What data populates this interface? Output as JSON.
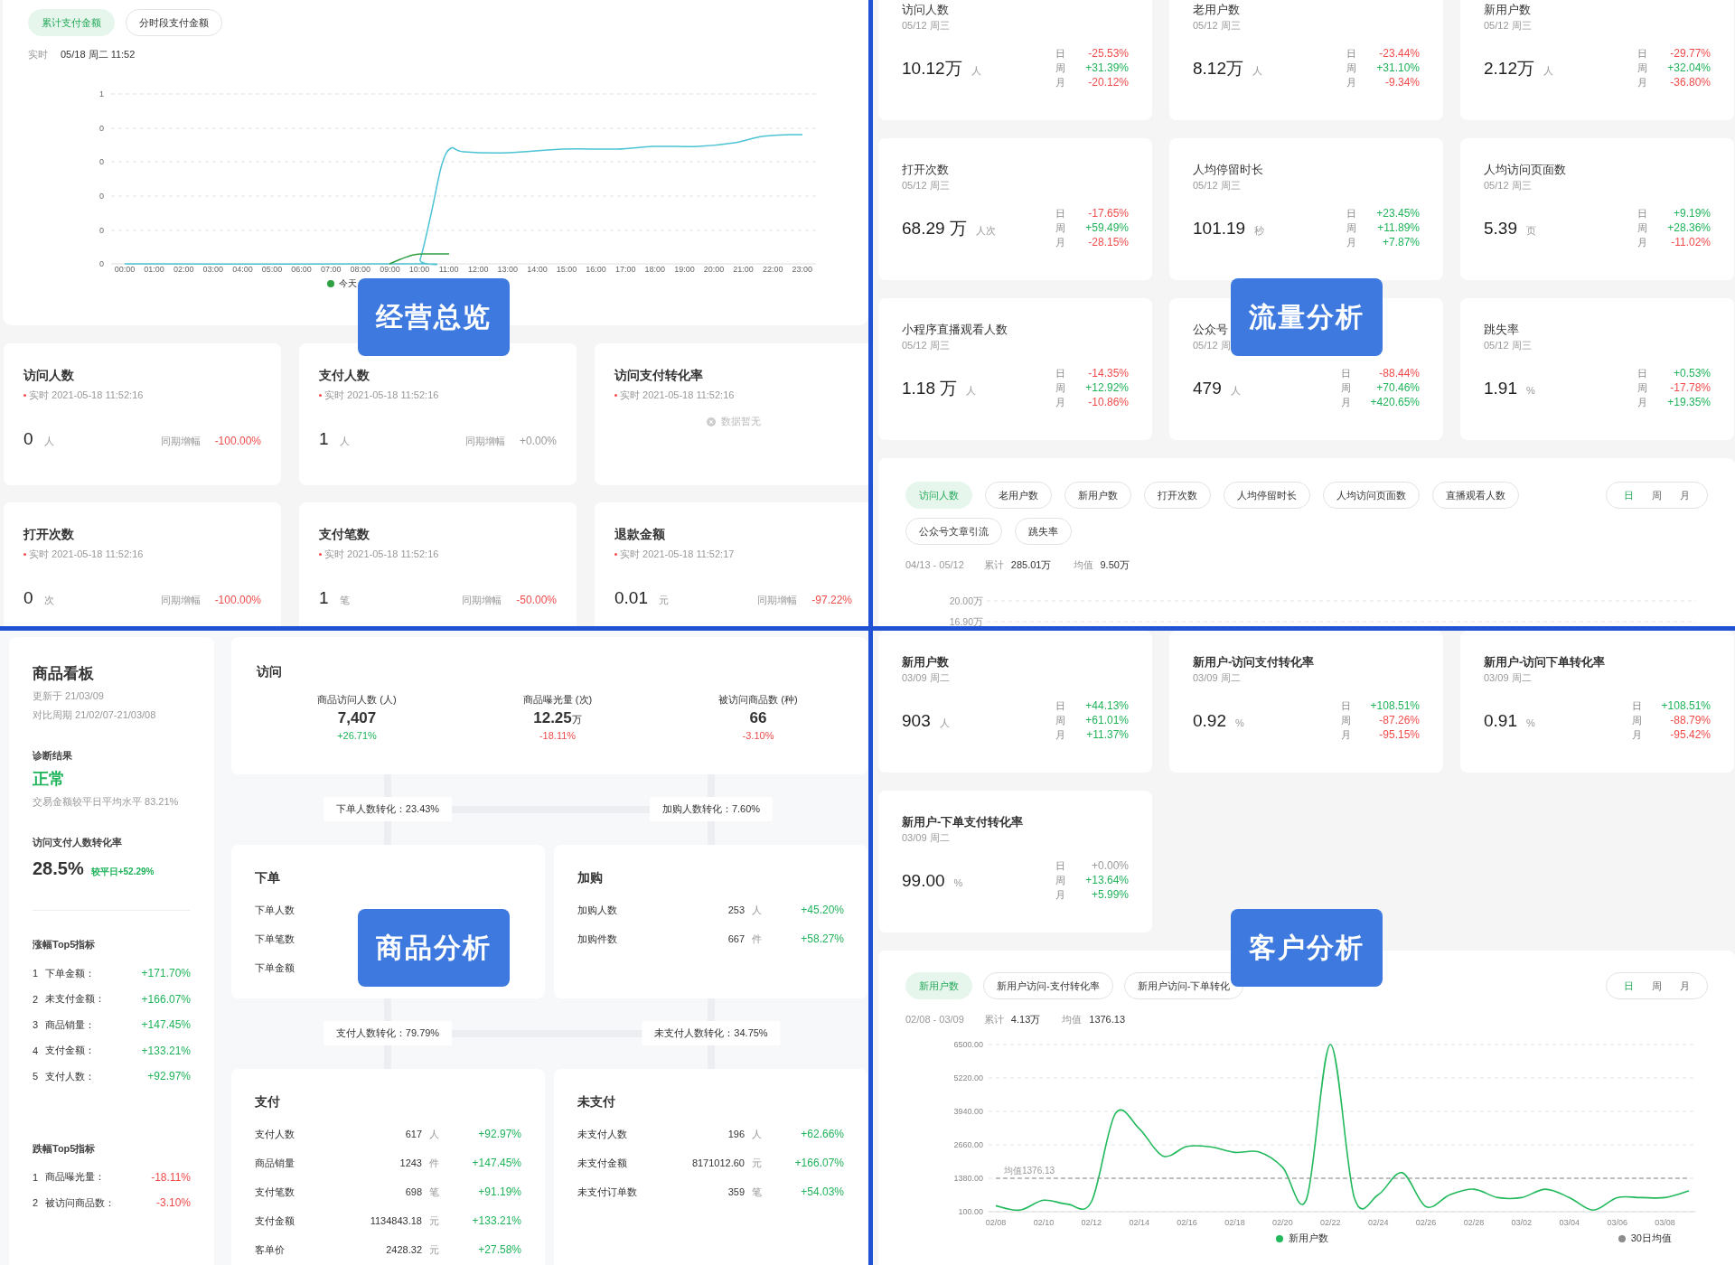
{
  "overview": {
    "overlay": "经营总览",
    "tabs": [
      {
        "label": "累计支付金额",
        "selected": true
      },
      {
        "label": "分时段支付金额",
        "selected": false
      }
    ],
    "realtime_label": "实时",
    "realtime_value": "05/18 周二 11:52",
    "chart": {
      "y_labels": [
        "1",
        "0",
        "0",
        "0",
        "0",
        "0"
      ],
      "x_labels": [
        "00:00",
        "01:00",
        "02:00",
        "03:00",
        "04:00",
        "05:00",
        "06:00",
        "07:00",
        "08:00",
        "09:00",
        "10:00",
        "11:00",
        "12:00",
        "13:00",
        "14:00",
        "15:00",
        "16:00",
        "17:00",
        "18:00",
        "19:00",
        "20:00",
        "21:00",
        "22:00",
        "23:00"
      ],
      "legend": "今天"
    },
    "cards": [
      {
        "kind": "metric",
        "title": "访问人数",
        "time": "实时 2021-05-18 11:52:16",
        "value": "0",
        "unit": "人",
        "change_label": "同期增幅",
        "change": "-100.00%",
        "color": "#f04b4b"
      },
      {
        "kind": "metric",
        "title": "支付人数",
        "time": "实时 2021-05-18 11:52:16",
        "value": "1",
        "unit": "人",
        "change_label": "同期增幅",
        "change": "+0.00%",
        "color": "#999999"
      },
      {
        "kind": "empty",
        "title": "访问支付转化率",
        "time": "实时 2021-05-18 11:52:16",
        "empty_text": "数据暂无"
      },
      {
        "kind": "metric",
        "title": "打开次数",
        "time": "实时 2021-05-18 11:52:16",
        "value": "0",
        "unit": "次",
        "change_label": "同期增幅",
        "change": "-100.00%",
        "color": "#f04b4b"
      },
      {
        "kind": "metric",
        "title": "支付笔数",
        "time": "实时 2021-05-18 11:52:16",
        "value": "1",
        "unit": "笔",
        "change_label": "同期增幅",
        "change": "-50.00%",
        "color": "#f04b4b"
      },
      {
        "kind": "metric",
        "title": "退款金额",
        "time": "实时 2021-05-18 11:52:17",
        "value": "0.01",
        "unit": "元",
        "change_label": "同期增幅",
        "change": "-97.22%",
        "color": "#f04b4b"
      }
    ]
  },
  "traffic": {
    "overlay": "流量分析",
    "cards": [
      {
        "title": "访问人数",
        "date": "05/12 周三",
        "value": "10.12万",
        "unit": "人",
        "changes": [
          {
            "period": "日",
            "value": "-25.53%",
            "color": "#f04b4b"
          },
          {
            "period": "周",
            "value": "+31.39%",
            "color": "#1fb35a"
          },
          {
            "period": "月",
            "value": "-20.12%",
            "color": "#f04b4b"
          }
        ]
      },
      {
        "title": "老用户数",
        "date": "05/12 周三",
        "value": "8.12万",
        "unit": "人",
        "changes": [
          {
            "period": "日",
            "value": "-23.44%",
            "color": "#f04b4b"
          },
          {
            "period": "周",
            "value": "+31.10%",
            "color": "#1fb35a"
          },
          {
            "period": "月",
            "value": "-9.34%",
            "color": "#f04b4b"
          }
        ]
      },
      {
        "title": "新用户数",
        "date": "05/12 周三",
        "value": "2.12万",
        "unit": "人",
        "changes": [
          {
            "period": "日",
            "value": "-29.77%",
            "color": "#f04b4b"
          },
          {
            "period": "周",
            "value": "+32.04%",
            "color": "#1fb35a"
          },
          {
            "period": "月",
            "value": "-36.80%",
            "color": "#f04b4b"
          }
        ]
      },
      {
        "title": "打开次数",
        "date": "05/12 周三",
        "value": "68.29 万",
        "unit": "人次",
        "changes": [
          {
            "period": "日",
            "value": "-17.65%",
            "color": "#f04b4b"
          },
          {
            "period": "周",
            "value": "+59.49%",
            "color": "#1fb35a"
          },
          {
            "period": "月",
            "value": "-28.15%",
            "color": "#f04b4b"
          }
        ]
      },
      {
        "title": "人均停留时长",
        "date": "05/12 周三",
        "value": "101.19",
        "unit": "秒",
        "changes": [
          {
            "period": "日",
            "value": "+23.45%",
            "color": "#1fb35a"
          },
          {
            "period": "周",
            "value": "+11.89%",
            "color": "#1fb35a"
          },
          {
            "period": "月",
            "value": "+7.87%",
            "color": "#1fb35a"
          }
        ]
      },
      {
        "title": "人均访问页面数",
        "date": "05/12 周三",
        "value": "5.39",
        "unit": "页",
        "changes": [
          {
            "period": "日",
            "value": "+9.19%",
            "color": "#1fb35a"
          },
          {
            "period": "周",
            "value": "+28.36%",
            "color": "#1fb35a"
          },
          {
            "period": "月",
            "value": "-11.02%",
            "color": "#f04b4b"
          }
        ]
      },
      {
        "title": "小程序直播观看人数",
        "date": "05/12 周三",
        "value": "1.18 万",
        "unit": "人",
        "changes": [
          {
            "period": "日",
            "value": "-14.35%",
            "color": "#f04b4b"
          },
          {
            "period": "周",
            "value": "+12.92%",
            "color": "#1fb35a"
          },
          {
            "period": "月",
            "value": "-10.86%",
            "color": "#f04b4b"
          }
        ]
      },
      {
        "title": "公众号",
        "date": "05/12 周",
        "value": "479",
        "unit": "人",
        "changes": [
          {
            "period": "日",
            "value": "-88.44%",
            "color": "#f04b4b"
          },
          {
            "period": "周",
            "value": "+70.46%",
            "color": "#1fb35a"
          },
          {
            "period": "月",
            "value": "+420.65%",
            "color": "#1fb35a"
          }
        ]
      },
      {
        "title": "跳失率",
        "date": "05/12 周三",
        "value": "1.91",
        "unit": "%",
        "changes": [
          {
            "period": "日",
            "value": "+0.53%",
            "color": "#1fb35a"
          },
          {
            "period": "周",
            "value": "-17.78%",
            "color": "#f04b4b"
          },
          {
            "period": "月",
            "value": "+19.35%",
            "color": "#1fb35a"
          }
        ]
      }
    ],
    "chart_panel": {
      "tabs": [
        {
          "label": "访问人数",
          "selected": true
        },
        {
          "label": "老用户数",
          "selected": false
        },
        {
          "label": "新用户数",
          "selected": false
        },
        {
          "label": "打开次数",
          "selected": false
        },
        {
          "label": "人均停留时长",
          "selected": false
        },
        {
          "label": "人均访问页面数",
          "selected": false
        },
        {
          "label": "直播观看人数",
          "selected": false
        },
        {
          "label": "公众号文章引流",
          "selected": false
        },
        {
          "label": "跳失率",
          "selected": false
        }
      ],
      "periods": [
        {
          "label": "日",
          "selected": true
        },
        {
          "label": "周",
          "selected": false
        },
        {
          "label": "月",
          "selected": false
        }
      ],
      "range": "04/13 - 05/12",
      "total_label": "累计",
      "total": "285.01万",
      "avg_label": "均值",
      "avg": "9.50万",
      "y_labels": [
        "20.00万",
        "16.90万"
      ]
    }
  },
  "products": {
    "overlay": "商品分析",
    "board": {
      "title": "商品看板",
      "updated": "更新于 21/03/09",
      "compare": "对比周期 21/02/07-21/03/08",
      "diag_label": "诊断结果",
      "diag_status": "正常",
      "diag_note": "交易金额较平日平均水平 83.21%",
      "rate_label": "访问支付人数转化率",
      "rate": "28.5%",
      "rate_change": "较平日+52.29%",
      "rise_title": "涨幅Top5指标",
      "rises": [
        {
          "rank": "1",
          "name": "下单金额：",
          "change": "+171.70%",
          "color": "#1fb35a"
        },
        {
          "rank": "2",
          "name": "未支付金额：",
          "change": "+166.07%",
          "color": "#1fb35a"
        },
        {
          "rank": "3",
          "name": "商品销量：",
          "change": "+147.45%",
          "color": "#1fb35a"
        },
        {
          "rank": "4",
          "name": "支付金额：",
          "change": "+133.21%",
          "color": "#1fb35a"
        },
        {
          "rank": "5",
          "name": "支付人数：",
          "change": "+92.97%",
          "color": "#1fb35a"
        }
      ],
      "fall_title": "跌幅Top5指标",
      "falls": [
        {
          "rank": "1",
          "name": "商品曝光量：",
          "change": "-18.11%",
          "color": "#f04b4b"
        },
        {
          "rank": "2",
          "name": "被访问商品数：",
          "change": "-3.10%",
          "color": "#f04b4b"
        }
      ]
    },
    "visit": {
      "title": "访问",
      "stats": [
        {
          "label": "商品访问人数 (人)",
          "value": "7,407",
          "change": "+26.71%",
          "color": "#1fb35a"
        },
        {
          "label": "商品曝光量 (次)",
          "value": "12.25",
          "unit": "万",
          "change": "-18.11%",
          "color": "#f04b4b"
        },
        {
          "label": "被访问商品数 (种)",
          "value": "66",
          "change": "-3.10%",
          "color": "#f04b4b"
        }
      ]
    },
    "conversions": [
      [
        "下单人数转化：23.43%",
        "加购人数转化：7.60%"
      ],
      [
        "支付人数转化：79.79%",
        "未支付人数转化：34.75%"
      ]
    ],
    "stages": [
      {
        "title": "下单",
        "rows": [
          {
            "label": "下单人数"
          },
          {
            "label": "下单笔数"
          },
          {
            "label": "下单金额"
          }
        ]
      },
      {
        "title": "加购",
        "rows": [
          {
            "label": "加购人数",
            "value": "253",
            "unit": "人",
            "change": "+45.20%",
            "color": "#1fb35a"
          },
          {
            "label": "加购件数",
            "value": "667",
            "unit": "件",
            "change": "+58.27%",
            "color": "#1fb35a"
          }
        ]
      },
      {
        "title": "支付",
        "rows": [
          {
            "label": "支付人数",
            "value": "617",
            "unit": "人",
            "change": "+92.97%",
            "color": "#1fb35a"
          },
          {
            "label": "商品销量",
            "value": "1243",
            "unit": "件",
            "change": "+147.45%",
            "color": "#1fb35a"
          },
          {
            "label": "支付笔数",
            "value": "698",
            "unit": "笔",
            "change": "+91.19%",
            "color": "#1fb35a"
          },
          {
            "label": "支付金额",
            "value": "1134843.18",
            "unit": "元",
            "change": "+133.21%",
            "color": "#1fb35a"
          },
          {
            "label": "客单价",
            "value": "2428.32",
            "unit": "元",
            "change": "+27.58%",
            "color": "#1fb35a"
          }
        ]
      },
      {
        "title": "未支付",
        "rows": [
          {
            "label": "未支付人数",
            "value": "196",
            "unit": "人",
            "change": "+62.66%",
            "color": "#1fb35a"
          },
          {
            "label": "未支付金额",
            "value": "8171012.60",
            "unit": "元",
            "change": "+166.07%",
            "color": "#1fb35a"
          },
          {
            "label": "未支付订单数",
            "value": "359",
            "unit": "笔",
            "change": "+54.03%",
            "color": "#1fb35a"
          }
        ]
      }
    ]
  },
  "customers": {
    "overlay": "客户分析",
    "cards": [
      {
        "title": "新用户数",
        "date": "03/09 周二",
        "value": "903",
        "unit": "人",
        "changes": [
          {
            "period": "日",
            "value": "+44.13%",
            "color": "#1fb35a"
          },
          {
            "period": "周",
            "value": "+61.01%",
            "color": "#1fb35a"
          },
          {
            "period": "月",
            "value": "+11.37%",
            "color": "#1fb35a"
          }
        ]
      },
      {
        "title": "新用户-访问支付转化率",
        "date": "03/09 周二",
        "value": "0.92",
        "unit": "%",
        "changes": [
          {
            "period": "日",
            "value": "+108.51%",
            "color": "#1fb35a"
          },
          {
            "period": "周",
            "value": "-87.26%",
            "color": "#f04b4b"
          },
          {
            "period": "月",
            "value": "-95.15%",
            "color": "#f04b4b"
          }
        ]
      },
      {
        "title": "新用户-访问下单转化率",
        "date": "03/09 周二",
        "value": "0.91",
        "unit": "%",
        "changes": [
          {
            "period": "日",
            "value": "+108.51%",
            "color": "#1fb35a"
          },
          {
            "period": "周",
            "value": "-88.79%",
            "color": "#f04b4b"
          },
          {
            "period": "月",
            "value": "-95.42%",
            "color": "#f04b4b"
          }
        ]
      },
      {
        "title": "新用户-下单支付转化率",
        "date": "03/09 周二",
        "value": "99.00",
        "unit": "%",
        "changes": [
          {
            "period": "日",
            "value": "+0.00%",
            "color": "#999999"
          },
          {
            "period": "周",
            "value": "+13.64%",
            "color": "#1fb35a"
          },
          {
            "period": "月",
            "value": "+5.99%",
            "color": "#1fb35a"
          }
        ]
      }
    ],
    "chart_panel": {
      "tabs": [
        {
          "label": "新用户数",
          "selected": true
        },
        {
          "label": "新用户访问-支付转化率",
          "selected": false
        },
        {
          "label": "新用户访问-下单转化",
          "selected": false
        }
      ],
      "periods": [
        {
          "label": "日",
          "selected": true
        },
        {
          "label": "周",
          "selected": false
        },
        {
          "label": "月",
          "selected": false
        }
      ],
      "range": "02/08 - 03/09",
      "total_label": "累计",
      "total": "4.13万",
      "avg_label": "均值",
      "avg": "1376.13",
      "chart_data": {
        "type": "line",
        "categories": [
          "02/08",
          null,
          "02/10",
          null,
          "02/12",
          null,
          "02/14",
          null,
          "02/16",
          null,
          "02/18",
          null,
          "02/20",
          null,
          "02/22",
          null,
          "02/24",
          null,
          "02/26",
          null,
          "02/28",
          null,
          "03/02",
          null,
          "03/04",
          null,
          "03/06",
          null,
          "03/08",
          null
        ],
        "ylim": [
          100,
          6500
        ],
        "yticks": [
          {
            "value": 100,
            "label": "100.00"
          },
          {
            "value": 1380,
            "label": "1380.00"
          },
          {
            "value": 2660,
            "label": "2660.00"
          },
          {
            "value": 3940,
            "label": "3940.00"
          },
          {
            "value": 5220,
            "label": "5220.00"
          },
          {
            "value": 6500,
            "label": "6500.00"
          }
        ],
        "series": [
          {
            "name": "新用户数",
            "color": "#22b95c",
            "line_style": "solid",
            "values": [
              330,
              160,
              540,
              390,
              480,
              3850,
              3280,
              2230,
              2600,
              2580,
              2370,
              2390,
              1800,
              580,
              6500,
              640,
              750,
              1590,
              290,
              750,
              960,
              640,
              640,
              960,
              640,
              160,
              640,
              640,
              640,
              900
            ]
          },
          {
            "name": "30日均值",
            "color": "#8c8c8c",
            "line_style": "dashed",
            "values": [
              1380,
              1380,
              1380,
              1380,
              1380,
              1380,
              1380,
              1380,
              1380,
              1380,
              1380,
              1380,
              1380,
              1380,
              1380,
              1380,
              1380,
              1380,
              1380,
              1380,
              1380,
              1380,
              1380,
              1380,
              1380,
              1380,
              1380,
              1380,
              1380,
              1380
            ]
          }
        ],
        "grid": true,
        "annotations": [
          {
            "text": "均值1376.13",
            "y": 1380
          }
        ]
      }
    }
  }
}
